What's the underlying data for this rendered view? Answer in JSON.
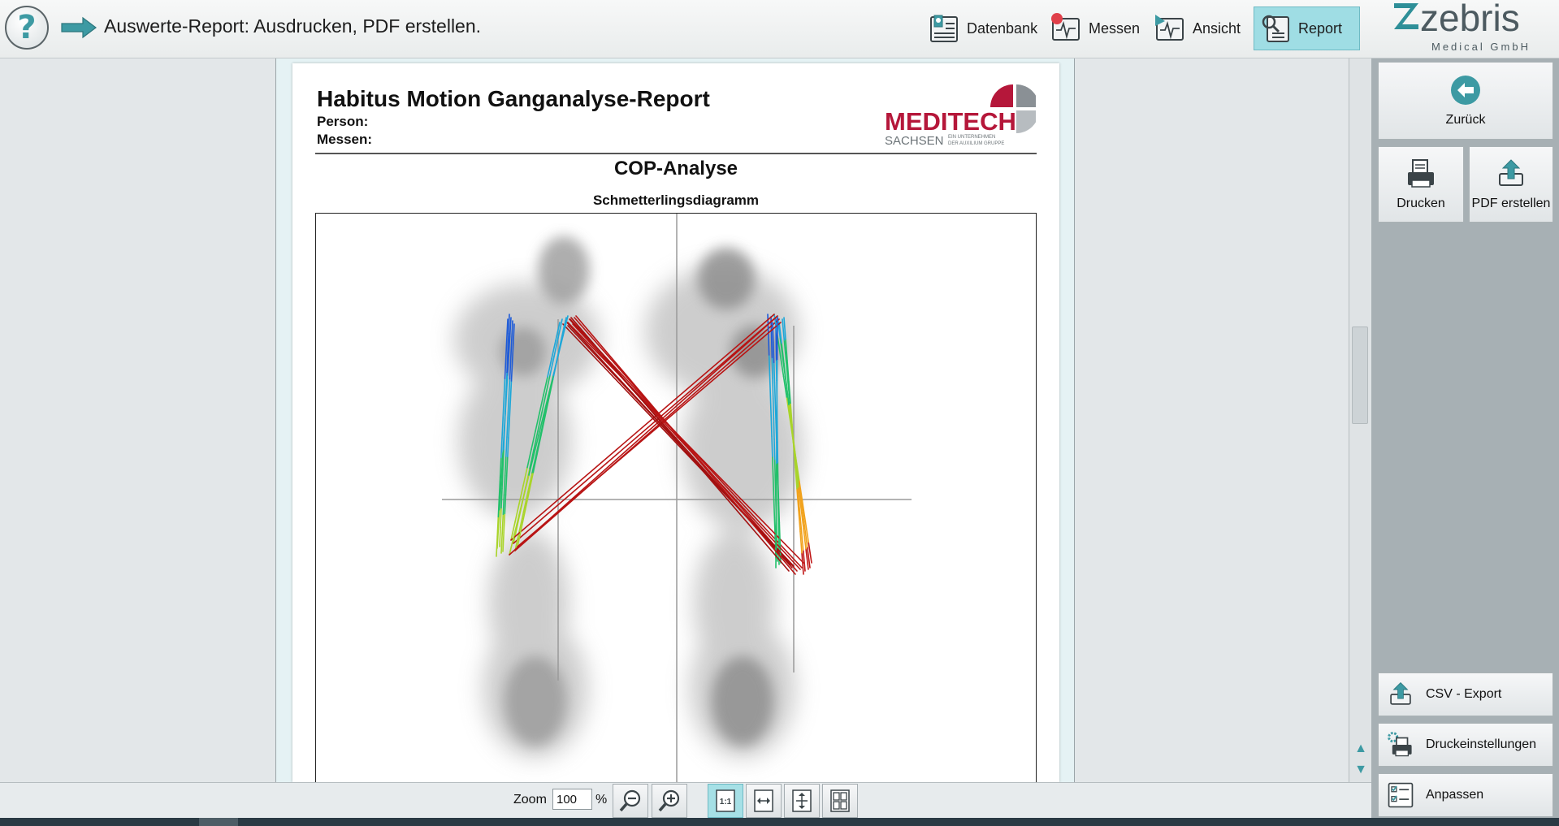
{
  "header": {
    "title": "Auswerte-Report: Ausdrucken, PDF erstellen.",
    "help_icon": "help-icon",
    "nav": [
      {
        "label": "Datenbank",
        "icon": "database-icon"
      },
      {
        "label": "Messen",
        "icon": "measure-icon"
      },
      {
        "label": "Ansicht",
        "icon": "view-icon"
      },
      {
        "label": "Report",
        "icon": "report-icon",
        "active": true
      }
    ],
    "logo": {
      "name": "zebris",
      "subtitle": "Medical GmbH"
    }
  },
  "report": {
    "title": "Habitus Motion Ganganalyse-Report",
    "person_label": "Person:",
    "measure_label": "Messen:",
    "brand_logo": {
      "name": "MEDITECH",
      "sub": "SACHSEN",
      "tagline_1": "EIN UNTERNEHMEN",
      "tagline_2": "DER AUXILIUM GRUPPE"
    },
    "section_title": "COP-Analyse",
    "chart_title": "Schmetterlingsdiagramm"
  },
  "chart_data": {
    "type": "line",
    "title": "Schmetterlingsdiagramm",
    "xlabel": "",
    "ylabel": "",
    "grid": false,
    "legend": "none",
    "colormap": [
      "#1e5bd8",
      "#1ea7d8",
      "#22c06a",
      "#a9d42a",
      "#f1a21c",
      "#c01818"
    ]
  },
  "actions": {
    "back": {
      "label": "Zurück",
      "icon": "back-arrow-icon"
    },
    "print": {
      "label": "Drucken",
      "icon": "printer-icon"
    },
    "pdf": {
      "label": "PDF erstellen",
      "icon": "upload-icon"
    },
    "csv": {
      "label": "CSV - Export",
      "icon": "export-icon"
    },
    "print_settings": {
      "label": "Druckeinstellungen",
      "icon": "print-settings-icon"
    },
    "customize": {
      "label": "Anpassen",
      "icon": "checklist-icon"
    }
  },
  "zoom": {
    "label": "Zoom",
    "value": "100",
    "unit": "%",
    "tools": [
      "zoom-out-icon",
      "zoom-in-icon",
      "actual-size-icon",
      "fit-width-icon",
      "fit-page-icon",
      "multi-page-icon"
    ]
  },
  "colors": {
    "accent": "#3d9aa3",
    "active": "#9fdde4",
    "brand_red": "#b5173a"
  }
}
